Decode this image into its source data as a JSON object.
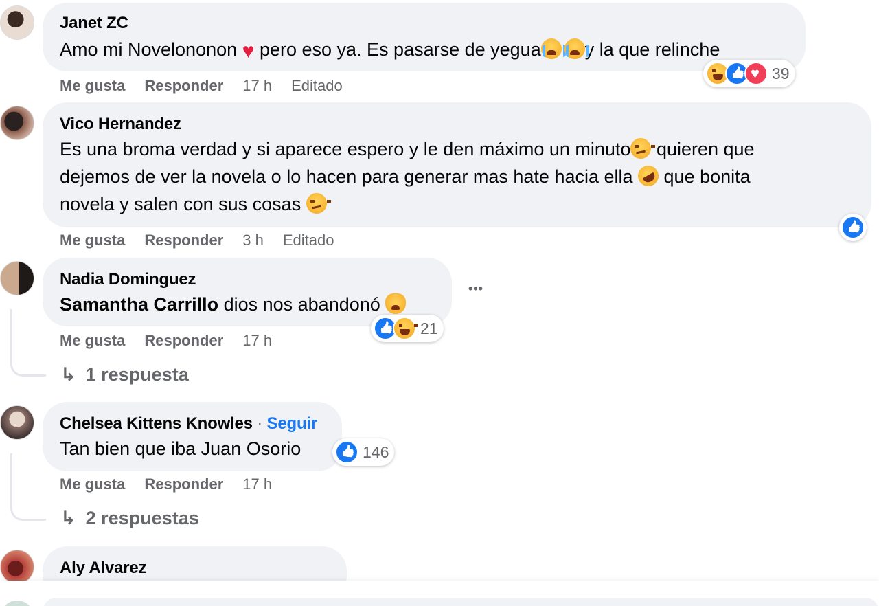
{
  "comments": [
    {
      "author": "Janet ZC",
      "text_before_heart": "Amo mi Novelononon ",
      "text_after_heart": " pero eso ya. Es pasarse de yegua",
      "text_end": "y la que relinche",
      "actions": {
        "like": "Me gusta",
        "reply": "Responder",
        "time": "17 h",
        "edited": "Editado"
      },
      "reactions": {
        "icons": [
          "haha-icon",
          "like-icon",
          "love-icon"
        ],
        "count": "39"
      },
      "avatar_color": "#d9cfc6"
    },
    {
      "author": "Vico Hernandez",
      "line1": "Es una broma verdad y si aparece espero y le den máximo un minuto",
      "line1_end": " quieren que",
      "line2": "dejemos de ver la novela o lo hacen para generar mas hate hacia ella ",
      "line2_end": " que bonita",
      "line3": "novela y salen con sus cosas ",
      "actions": {
        "like": "Me gusta",
        "reply": "Responder",
        "time": "3 h",
        "edited": "Editado"
      },
      "reactions": {
        "icons": [
          "like-icon"
        ]
      },
      "avatar_color": "#6b4a3a"
    },
    {
      "author": "Nadia Dominguez",
      "mention": "Samantha Carrillo",
      "text": " dios nos abandonó ",
      "actions": {
        "like": "Me gusta",
        "reply": "Responder",
        "time": "17 h"
      },
      "reactions": {
        "icons": [
          "like-icon",
          "haha-icon"
        ],
        "count": "21"
      },
      "replies_label": "1 respuesta",
      "more_label": "•••",
      "avatar_color": "#b89a82"
    },
    {
      "author": "Chelsea Kittens Knowles",
      "separator": " · ",
      "follow_label": "Seguir",
      "text": "Tan bien que iba Juan Osorio",
      "actions": {
        "like": "Me gusta",
        "reply": "Responder",
        "time": "17 h"
      },
      "reactions": {
        "icons": [
          "like-icon"
        ],
        "count": "146"
      },
      "replies_label": "2 respuestas",
      "avatar_color": "#a88f86"
    },
    {
      "author": "Aly Alvarez",
      "avatar_color": "#b5403a"
    }
  ],
  "colors": {
    "bubble": "#f0f2f5",
    "link_blue": "#1877f2",
    "secondary_text": "#65676b",
    "love_red": "#f33e58"
  }
}
